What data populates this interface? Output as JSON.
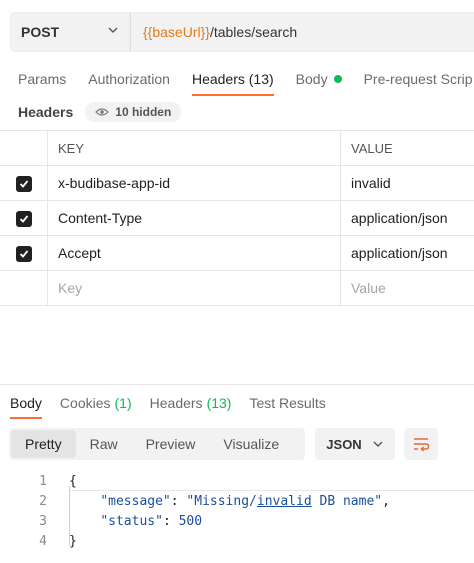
{
  "request": {
    "method": "POST",
    "url_var": "{{baseUrl}}",
    "url_path": "/tables/search"
  },
  "tabs": [
    {
      "label": "Params"
    },
    {
      "label": "Authorization"
    },
    {
      "label": "Headers (13)"
    },
    {
      "label": "Body"
    },
    {
      "label": "Pre-request Scrip"
    }
  ],
  "headers_section": {
    "label": "Headers",
    "hidden_pill": "10 hidden"
  },
  "table": {
    "col_key": "KEY",
    "col_value": "VALUE",
    "rows": [
      {
        "key": "x-budibase-app-id",
        "value": "invalid"
      },
      {
        "key": "Content-Type",
        "value": "application/json"
      },
      {
        "key": "Accept",
        "value": "application/json"
      }
    ],
    "placeholder_key": "Key",
    "placeholder_value": "Value"
  },
  "response": {
    "tabs": [
      {
        "label": "Body"
      },
      {
        "label": "Cookies",
        "count": "(1)"
      },
      {
        "label": "Headers",
        "count": "(13)"
      },
      {
        "label": "Test Results"
      }
    ],
    "view_modes": [
      "Pretty",
      "Raw",
      "Preview",
      "Visualize"
    ],
    "format": "JSON",
    "code": {
      "line_numbers": [
        "1",
        "2",
        "3",
        "4"
      ],
      "open_brace": "{",
      "close_brace": "}",
      "message_key": "\"message\"",
      "message_value_pre": "\"Missing/",
      "message_value_ul": "invalid",
      "message_value_post": " DB name\"",
      "status_key": "\"status\"",
      "status_value": "500"
    }
  },
  "colors": {
    "accent": "#ff6c37",
    "variable": "#e87813",
    "success": "#0cbb52"
  }
}
